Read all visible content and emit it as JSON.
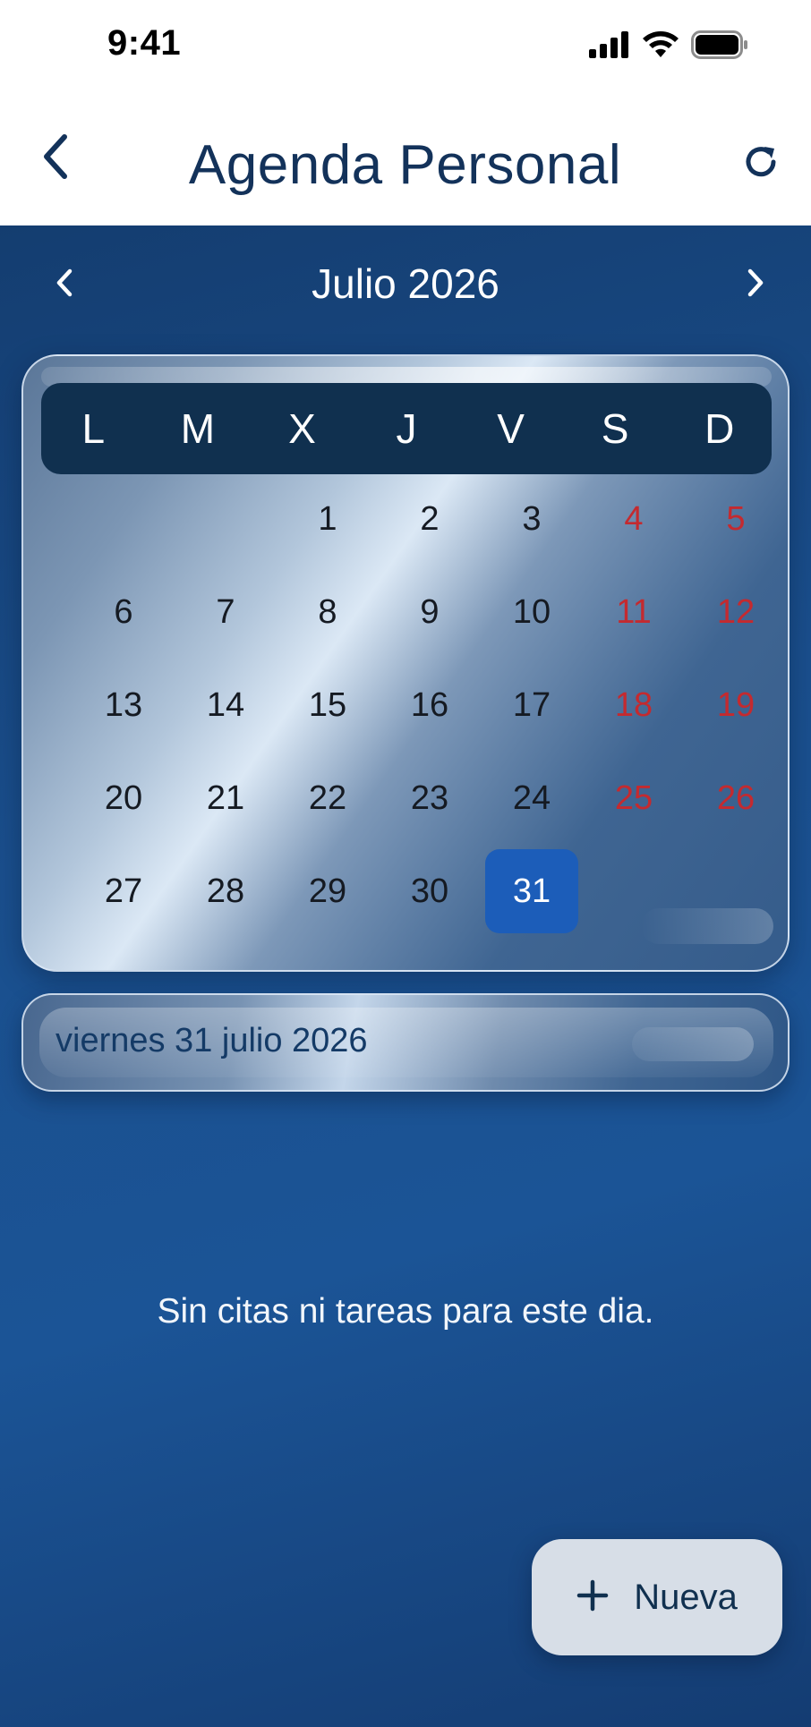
{
  "status_bar": {
    "time": "9:41",
    "icons": [
      "cellular-signal-icon",
      "wifi-icon",
      "battery-icon"
    ]
  },
  "header": {
    "title": "Agenda Personal",
    "back_icon": "chevron-left-icon",
    "refresh_icon": "refresh-icon"
  },
  "calendar": {
    "month_label": "Julio 2026",
    "weekdays": [
      "L",
      "M",
      "X",
      "J",
      "V",
      "S",
      "D"
    ],
    "weeks": [
      [
        "",
        "",
        "1",
        "2",
        "3",
        "4",
        "5"
      ],
      [
        "6",
        "7",
        "8",
        "9",
        "10",
        "11",
        "12"
      ],
      [
        "13",
        "14",
        "15",
        "16",
        "17",
        "18",
        "19"
      ],
      [
        "20",
        "21",
        "22",
        "23",
        "24",
        "25",
        "26"
      ],
      [
        "27",
        "28",
        "29",
        "30",
        "31",
        "",
        ""
      ]
    ],
    "selected_day": "31",
    "weekend_color": "#c42a2f",
    "selected_color": "#1c5db9"
  },
  "selected_date": {
    "label": "viernes 31 julio 2026"
  },
  "empty_state": {
    "message": "Sin citas ni tareas para este dia."
  },
  "fab": {
    "icon": "plus-icon",
    "label": "Nueva"
  },
  "colors": {
    "background": "#1a4f8d",
    "title": "#13325a",
    "weekday_header": "#10304f"
  }
}
